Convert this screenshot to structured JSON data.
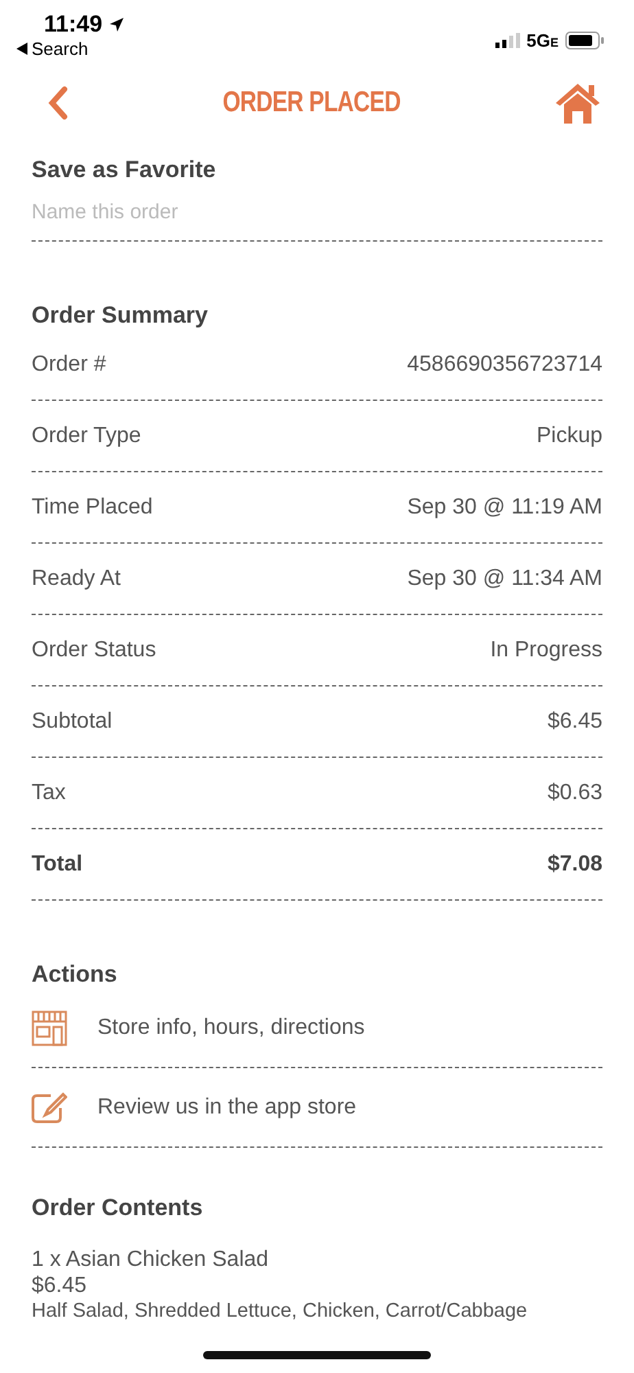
{
  "status_bar": {
    "time": "11:49",
    "back_label": "Search",
    "network": "5G",
    "network_suffix": "E"
  },
  "header": {
    "title": "ORDER PLACED"
  },
  "favorite": {
    "heading": "Save as Favorite",
    "placeholder": "Name this order"
  },
  "summary": {
    "heading": "Order Summary",
    "rows": [
      {
        "label": "Order #",
        "value": "4586690356723714",
        "bold": false
      },
      {
        "label": "Order Type",
        "value": "Pickup",
        "bold": false
      },
      {
        "label": "Time Placed",
        "value": "Sep 30 @ 11:19 AM",
        "bold": false
      },
      {
        "label": "Ready At",
        "value": "Sep 30 @ 11:34 AM",
        "bold": false
      },
      {
        "label": "Order Status",
        "value": "In Progress",
        "bold": false
      },
      {
        "label": "Subtotal",
        "value": "$6.45",
        "bold": false
      },
      {
        "label": "Tax",
        "value": "$0.63",
        "bold": false
      },
      {
        "label": "Total",
        "value": "$7.08",
        "bold": true
      }
    ]
  },
  "actions": {
    "heading": "Actions",
    "items": [
      {
        "kind": "store",
        "label": "Store info, hours, directions"
      },
      {
        "kind": "review",
        "label": "Review us in the app store"
      }
    ]
  },
  "contents": {
    "heading": "Order Contents",
    "items": [
      {
        "name": "1 x Asian Chicken Salad",
        "price": "$6.45",
        "details": "Half Salad, Shredded Lettuce, Chicken, Carrot/Cabbage"
      }
    ]
  }
}
